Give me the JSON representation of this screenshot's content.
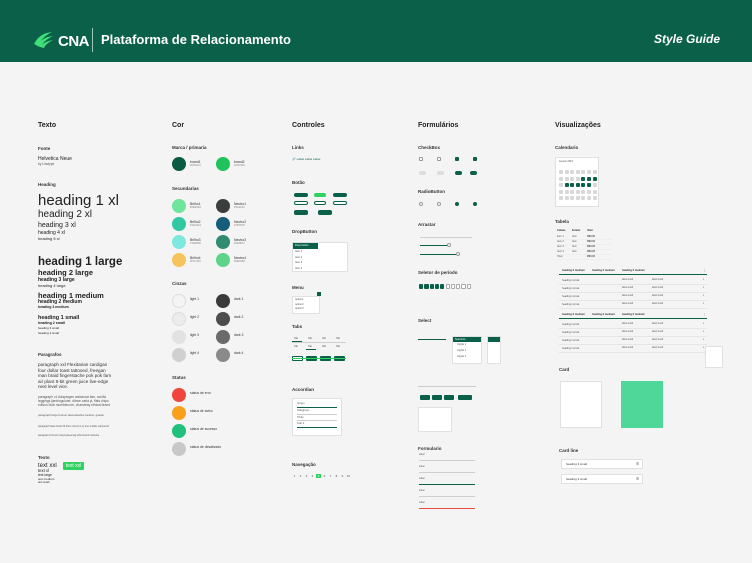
{
  "header": {
    "brand": "CNA",
    "title": "Plataforma de Relacionamento",
    "right": "Style Guide"
  },
  "texto": {
    "title": "Texto",
    "fonte": "Fonte",
    "font_name": "Helvetica Neue",
    "font_sub": "by Linotype",
    "heading": "Heading",
    "h1xl": "heading 1 xl",
    "h2xl": "heading 2 xl",
    "h3xl": "heading 3 xl",
    "h4xl": "heading 4 xl",
    "h5xl": "heading 5 xl",
    "h1l": "heading 1 large",
    "h2l": "heading 2 large",
    "h3l": "heading 3 large",
    "h4l": "heading 4 large",
    "h5l": "heading 5 large",
    "h1m": "heading 1 medium",
    "h2m": "heading 2 medium",
    "h3m": "heading 3 medium",
    "h1s": "heading 1 small",
    "h2s": "heading 2 small",
    "h3s": "heading 3 small",
    "h4s": "heading 4 small",
    "paragrafos": "Paragrafos",
    "p1": [
      "paragraph xxl Flexitarian cardigan",
      "four dollar toast tattooed, freegan",
      "man braid fingerstache pok pok fam",
      "air plant 8-bit green juice live-edge",
      "next level vice."
    ],
    "p2": [
      "paragraph x1 Adaptogen waistcoat fam, schlitz",
      "leggings jianbingcloter, diirwe carla yl, flats chips",
      "edison bulb mumblecore, chambray ethical brand"
    ],
    "p3": "paragraph large forever alamasbeline locavor, gastan",
    "p4": "paragraph base brash fit tham nimvit nt ty true mobile reicluerod",
    "p5": "paragraph s3 lorem rastrying/sesrvag wtha tostnoti ndotetoe",
    "texto": "Texto",
    "txl": "text xxl",
    "txl2": "text xl",
    "tlg": "text large",
    "tmd": "text medium",
    "tsm": "text small",
    "tbadge": "text xxl"
  },
  "cor": {
    "title": "Cor",
    "marca": "Marca / primaria",
    "secundarias": "Secundarias",
    "cinzas": "Cinzas",
    "status": "Status",
    "brand": [
      {
        "name": "brand1",
        "hex": "#0a5a44",
        "code": "#0A5A44"
      },
      {
        "name": "brand2",
        "hex": "#20c35a",
        "code": "#20C35A"
      }
    ],
    "sec": [
      {
        "name": "Brilho1",
        "hex": "#6ee59a",
        "code": "#6EE59A"
      },
      {
        "name": "Neutro1",
        "hex": "#3a3f3c",
        "code": "#3A3F3C"
      },
      {
        "name": "Brilho2",
        "hex": "#33c8a4",
        "code": "#33C8A4"
      },
      {
        "name": "Neutro2",
        "hex": "#155d78",
        "code": "#155D78"
      },
      {
        "name": "Brilho3",
        "hex": "#7ee8df",
        "code": "#7EE8DF"
      },
      {
        "name": "Neutro3",
        "hex": "#2f8b72",
        "code": "#2F8B72"
      },
      {
        "name": "Brilho4",
        "hex": "#f5c45c",
        "code": "#F5C45C"
      },
      {
        "name": "Neutro4",
        "hex": "#5ed389",
        "code": "#5ED389"
      }
    ],
    "grays": [
      {
        "name": "light 1",
        "hex": "#f4f4f4"
      },
      {
        "name": "dark 1",
        "hex": "#3a3a3a"
      },
      {
        "name": "light 2",
        "hex": "#ececec"
      },
      {
        "name": "dark 2",
        "hex": "#4d4d4d"
      },
      {
        "name": "light 3",
        "hex": "#e2e2e2"
      },
      {
        "name": "dark 3",
        "hex": "#6a6a6a"
      },
      {
        "name": "light 4",
        "hex": "#d0d0d0"
      },
      {
        "name": "dark 4",
        "hex": "#8a8a8a"
      }
    ],
    "statuses": [
      {
        "name": "status de erro",
        "hex": "#f0443c"
      },
      {
        "name": "status de aviso",
        "hex": "#f9a01b"
      },
      {
        "name": "status de sucesso",
        "hex": "#1ec07a"
      },
      {
        "name": "status de desativado",
        "hex": "#c8c8c8"
      }
    ]
  },
  "controles": {
    "title": "Controles",
    "links": "Links",
    "botao": "Botão",
    "dropbutton": "DropButton",
    "menu": "Menu",
    "tabs": "Tabs",
    "accordian": "Accordian",
    "navegacao": "Navegação",
    "link_label": "Label",
    "drop_head": "Drop button",
    "drop_items": [
      "Item 1",
      "Item 2",
      "Item 3",
      "Item 4"
    ],
    "menu_items": [
      "option1",
      "option2",
      "option3"
    ],
    "tab_label": "Tab",
    "acc_items": [
      "Grupo",
      "Subgrupo",
      "Titulo",
      "Sub 2"
    ],
    "nav_pages": [
      "1",
      "2",
      "3",
      "4",
      "5",
      "6",
      "7",
      "8",
      "9",
      "10"
    ]
  },
  "formularios": {
    "title": "Formulários",
    "checkbox": "CheckBox",
    "radiobutton": "RadioButton",
    "arrastar": "Arrastar",
    "seletor": "Seletor de período",
    "select": "Select",
    "formulario": "Formulario",
    "label": "Label",
    "select_head": "Selecione",
    "select_items": [
      "Opção 1",
      "Opção 2",
      "Opção 3"
    ]
  },
  "visualizacoes": {
    "title": "Visualizações",
    "calendario": "Calendario",
    "cal_month": "Janeiro 2019",
    "tabela": "Tabela",
    "card": "Card",
    "cardline": "Card line",
    "table_cols": [
      "Cidade",
      "Estado",
      "Valor"
    ],
    "table_rows": [
      [
        "item 1",
        "Item",
        "R$0,00"
      ],
      [
        "Item 2",
        "Item",
        "R$0,00"
      ],
      [
        "Item 3",
        "Item",
        "R$0,00"
      ],
      [
        "Item 4",
        "Item",
        "R$0,00"
      ],
      [
        "Total",
        "",
        "R$0,00"
      ]
    ],
    "big_cols": [
      "heading 6 medium",
      "heading 6 medium",
      "heading 6 medium"
    ],
    "big_cell": "heading normal",
    "big_val": "label small",
    "cardline_items": [
      "heading 3 small",
      "heading 3 small"
    ]
  }
}
